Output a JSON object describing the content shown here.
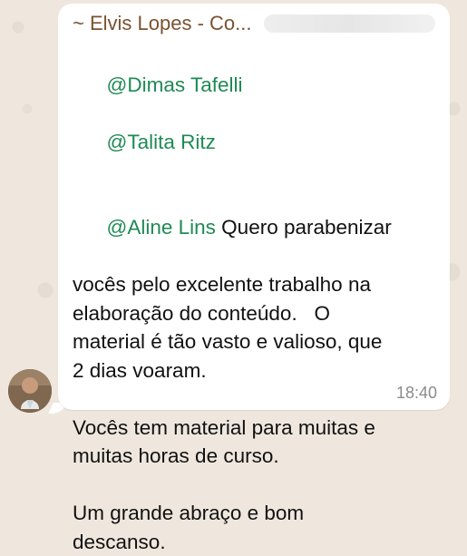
{
  "message": {
    "sender_name": "~ Elvis Lopes - Co...",
    "mention_1": "@Dimas Tafelli",
    "mention_2": "@Talita Ritz",
    "mention_3": "@Aline Lins",
    "line_1_text": " Quero parabenizar",
    "line_2": "vocês pelo excelente trabalho na",
    "line_3": "elaboração do conteúdo.   O",
    "line_4": "material é tão vasto e valioso, que",
    "line_5": "2 dias voaram.",
    "line_6": "Vocês tem material para muitas e",
    "line_7": "muitas horas de curso.",
    "line_8": "Um grande abraço e bom",
    "line_9": "descanso.",
    "timestamp": "18:40"
  },
  "colors": {
    "mention": "#1f8a55",
    "sender": "#7a5230",
    "background": "#efe7de",
    "bubble": "#ffffff"
  },
  "icons": {
    "avatar": "person-photo"
  }
}
